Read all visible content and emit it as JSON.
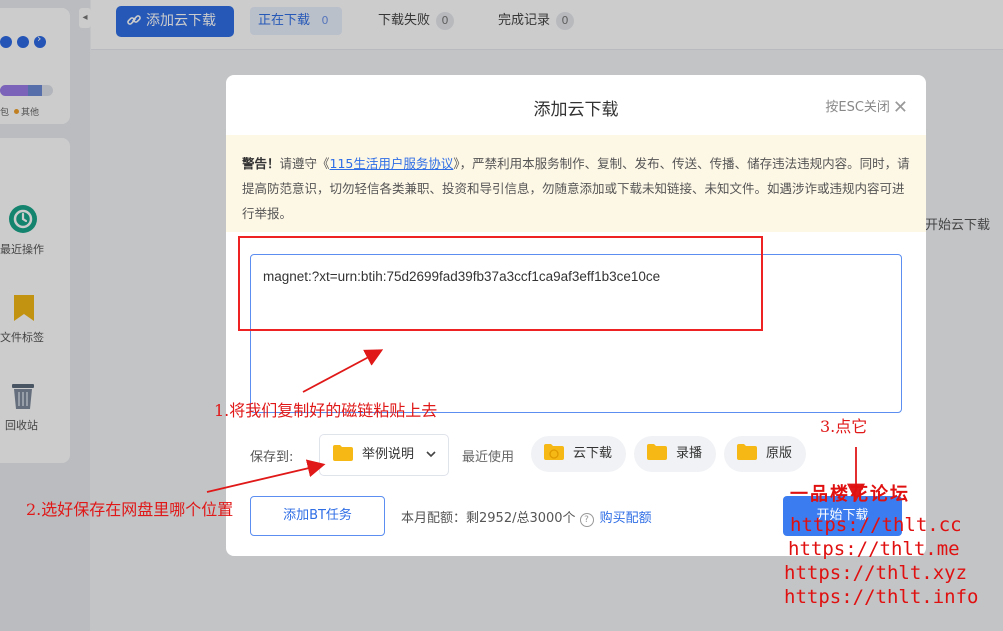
{
  "sidebar": {
    "storage_legend": [
      "包",
      "其他"
    ],
    "items": [
      {
        "label": "最近操作",
        "icon": "clock-history-icon"
      },
      {
        "label": "文件标签",
        "icon": "bookmark-icon"
      },
      {
        "label": "回收站",
        "icon": "trash-icon"
      }
    ]
  },
  "topbar": {
    "add_button": "添加云下载",
    "tabs": [
      {
        "label": "正在下载",
        "count": "0",
        "active": true
      },
      {
        "label": "下载失败",
        "count": "0",
        "active": false
      },
      {
        "label": "完成记录",
        "count": "0",
        "active": false
      }
    ]
  },
  "background": {
    "start_label": "开始云下载"
  },
  "modal": {
    "title": "添加云下载",
    "esc_close": "按ESC关闭",
    "warning": {
      "bold": "警告！",
      "prefix": "请遵守《",
      "link": "115生活用户服务协议",
      "suffix": "》，严禁利用本服务制作、复制、发布、传送、传播、储存违法违规内容。同时，请提高防范意识，切勿轻信各类兼职、投资和导引信息，勿随意添加或下载未知链接、未知文件。如遇涉诈或违规内容可进行举报。"
    },
    "link_value": "magnet:?xt=urn:btih:75d2699fad39fb37a3ccf1ca9af3eff1b3ce10ce",
    "save_to_label": "保存到:",
    "save_folder": "举例说明",
    "recent_label": "最近使用",
    "recent_folders": [
      "云下载",
      "录播",
      "原版"
    ],
    "bt_button": "添加BT任务",
    "quota_text": "本月配额：剩2952/总3000个",
    "buy_quota": "购买配额",
    "start_button": "开始下载"
  },
  "annotations": {
    "step1": "1.将我们复制好的磁链粘贴上去",
    "step2": "2.选好保存在网盘里哪个位置",
    "step3": "3.点它",
    "forum": "一品楼花论坛",
    "urls": [
      "https://thlt.cc",
      "https://thlt.me",
      "https://thlt.xyz",
      "https://thlt.info"
    ]
  },
  "colors": {
    "accent": "#2f6ee5",
    "annotation_red": "#e01818",
    "warning_bg": "#fdf7e6"
  }
}
